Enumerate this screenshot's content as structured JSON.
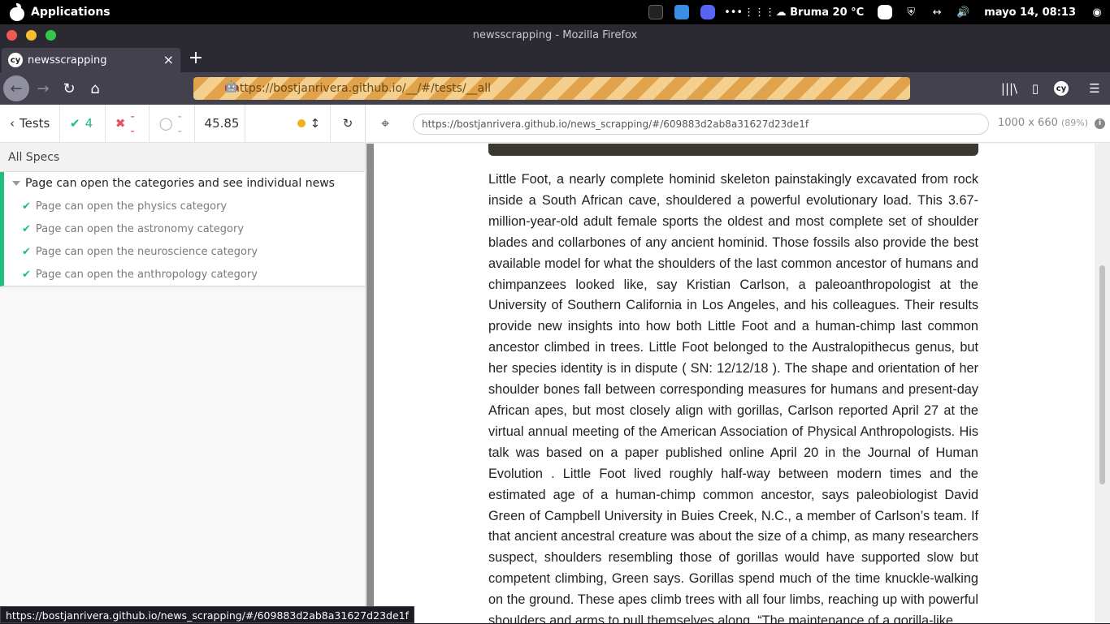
{
  "panel": {
    "apps_label": "Applications",
    "weather": "☁ Bruma 20 °C",
    "clock": "mayo 14, 08:13"
  },
  "window": {
    "title": "newsscrapping - Mozilla Firefox"
  },
  "tab": {
    "badge": "cy",
    "title": "newsscrapping",
    "close": "×"
  },
  "navbar": {
    "url": "https://bostjanrivera.github.io/__/#/tests/__all"
  },
  "reporter": {
    "tests_label": "Tests",
    "passed": "4",
    "failed": "--",
    "pending": "--",
    "duration": "45.85",
    "all_specs": "All Specs",
    "suite_title": "Page can open the categories and see individual news",
    "tests": [
      "Page can open the physics category",
      "Page can open the astronomy category",
      "Page can open the neuroscience category",
      "Page can open the anthropology category"
    ]
  },
  "aut": {
    "url": "https://bostjanrivera.github.io/news_scrapping/#/609883d2ab8a31627d23de1f",
    "size": "1000 x 660",
    "scale": "(89%)",
    "article": "Little Foot, a nearly complete hominid skeleton painstakingly excavated from rock inside a South African cave, shouldered a powerful evolutionary load. This 3.67-million-year-old adult female sports the oldest and most complete set of shoulder blades and collarbones of any ancient hominid. Those fossils also provide the best available model for what the shoulders of the last common ancestor of humans and chimpanzees looked like, say Kristian Carlson, a paleoanthropologist at the University of Southern California in Los Angeles, and his colleagues. Their results provide new insights into how both Little Foot and a human-chimp last common ancestor climbed in trees. Little Foot belonged to the Australopithecus genus, but her species identity is in dispute ( SN: 12/12/18 ). The shape and orientation of her shoulder bones fall between corresponding measures for humans and present-day African apes, but most closely align with gorillas, Carlson reported April 27 at the virtual annual meeting of the American Association of Physical Anthropologists. His talk was based on a paper published online April 20 in the Journal of Human Evolution . Little Foot lived roughly half-way between modern times and the estimated age of a human-chimp common ancestor, says paleobiologist David Green of Campbell University in Buies Creek, N.C., a member of Carlson’s team. If that ancient ancestral creature was about the size of a chimp, as many researchers suspect, shoulders resembling those of gorillas would have supported slow but competent climbing, Green says. Gorillas spend much of the time knuckle-walking on the ground. These apes climb trees with all four limbs, reaching up with powerful shoulders and arms to pull themselves along. “The maintenance of a gorilla-like"
  },
  "statusbar": {
    "text": "https://bostjanrivera.github.io/news_scrapping/#/609883d2ab8a31627d23de1f"
  },
  "colors": {
    "pass": "#1fbd7e",
    "fail": "#e94f5f",
    "running_dot": "#f2b01e"
  }
}
